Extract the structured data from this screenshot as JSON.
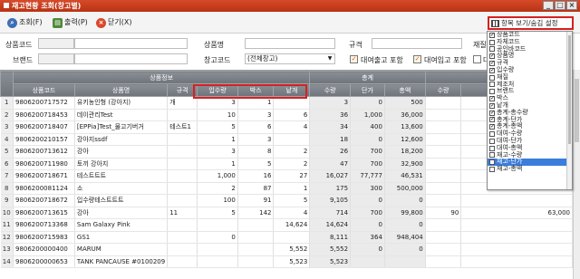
{
  "window": {
    "title": "재고현황 조회(창고별)",
    "controls": [
      "_",
      "□",
      "×"
    ]
  },
  "toolbar": {
    "search": "조회(F)",
    "print": "출력(P)",
    "close": "닫기(X)",
    "settings": "항목 보기/숨김 설정"
  },
  "filters": {
    "product_code_label": "상품코드",
    "product_name_label": "상품명",
    "spec_label": "규격",
    "material_label": "재질",
    "brand_label": "브랜드",
    "warehouse_code_label": "창고코드",
    "warehouse_value": "(전체창고)",
    "include_rental_out": "대여출고 포함",
    "include_rental_in": "대여입고 포함",
    "include_rental_extra": "대"
  },
  "grid": {
    "group_headers": {
      "product_info": "상품정보",
      "total": "총계",
      "rental": "대여"
    },
    "headers": [
      "",
      "상품코드",
      "상품명",
      "규격",
      "입수량",
      "박스",
      "낱개",
      "수량",
      "단가",
      "총액",
      "수량",
      "단가"
    ],
    "rows": [
      [
        "1",
        "9806200717572",
        "유키농인형   (강아지)",
        "개",
        "3",
        "1",
        "",
        "3",
        "0",
        "500",
        "",
        ""
      ],
      [
        "2",
        "9806200718453",
        "데이관리Test",
        "",
        "10",
        "3",
        "6",
        "36",
        "1,000",
        "36,000",
        "",
        ""
      ],
      [
        "3",
        "9806200718407",
        "[EPPia]Test_물고기버거",
        "테스트1",
        "5",
        "6",
        "4",
        "34",
        "400",
        "13,600",
        "",
        ""
      ],
      [
        "4",
        "9806200210157",
        "강아지ssdf",
        "",
        "1",
        "3",
        "",
        "18",
        "0",
        "12,600",
        "",
        ""
      ],
      [
        "5",
        "9806200713612",
        "강아",
        "",
        "3",
        "8",
        "2",
        "26",
        "700",
        "18,200",
        "",
        ""
      ],
      [
        "6",
        "9806200711980",
        "토끼 강아지",
        "",
        "1",
        "5",
        "2",
        "47",
        "700",
        "32,900",
        "",
        ""
      ],
      [
        "7",
        "9806200718671",
        "테스트트트",
        "",
        "1,000",
        "16",
        "27",
        "16,027",
        "77,777",
        "46,531",
        "",
        ""
      ],
      [
        "8",
        "9806200081124",
        "소",
        "",
        "2",
        "87",
        "1",
        "175",
        "300",
        "500,000",
        "",
        ""
      ],
      [
        "9",
        "9806200718672",
        "입수량테스트트트",
        "",
        "100",
        "91",
        "5",
        "9,105",
        "0",
        "0",
        "",
        ""
      ],
      [
        "10",
        "9806200713615",
        "강아",
        "11",
        "5",
        "142",
        "4",
        "714",
        "700",
        "99,800",
        "90",
        "63,000"
      ],
      [
        "11",
        "9806200713368",
        "Sam        Galaxy        Pink",
        "",
        "",
        "",
        "14,624",
        "14,624",
        "0",
        "0",
        "",
        ""
      ],
      [
        "12",
        "9806200715983",
        "GS1",
        "",
        "0",
        "",
        "",
        "8,111",
        "364",
        "948,404",
        "",
        ""
      ],
      [
        "13",
        "9806200000400",
        "MARUM",
        "",
        "",
        "",
        "5,552",
        "5,552",
        "0",
        "0",
        "",
        ""
      ],
      [
        "14",
        "9806200000653",
        "TANK PANCAUSE #0100209",
        "",
        "",
        "",
        "5,523",
        "5,523",
        "",
        "",
        "",
        ""
      ]
    ]
  },
  "column_menu": {
    "items": [
      {
        "label": "상품코드",
        "checked": true
      },
      {
        "label": "자체코드",
        "checked": false
      },
      {
        "label": "공인바코드",
        "checked": false
      },
      {
        "label": "상품명",
        "checked": true
      },
      {
        "label": "규격",
        "checked": true
      },
      {
        "label": "입수량",
        "checked": true
      },
      {
        "label": "재질",
        "checked": false
      },
      {
        "label": "제조처",
        "checked": false
      },
      {
        "label": "브랜드",
        "checked": false
      },
      {
        "label": "박스",
        "checked": true
      },
      {
        "label": "낱개",
        "checked": true
      },
      {
        "label": "총계-총수량",
        "checked": true
      },
      {
        "label": "총계-단가",
        "checked": true
      },
      {
        "label": "총계-총액",
        "checked": true
      },
      {
        "label": "대여-수량",
        "checked": false
      },
      {
        "label": "대여-단가",
        "checked": false
      },
      {
        "label": "대여-총액",
        "checked": false
      },
      {
        "label": "재고-수량",
        "checked": false
      },
      {
        "label": "재고-단가",
        "checked": false,
        "selected": true
      },
      {
        "label": "재고-총액",
        "checked": false
      }
    ]
  },
  "colors": {
    "title_bar": "#c83d1d",
    "highlight": "#d62020",
    "header_bg": "#7d8289",
    "selection": "#3b7ddb"
  }
}
